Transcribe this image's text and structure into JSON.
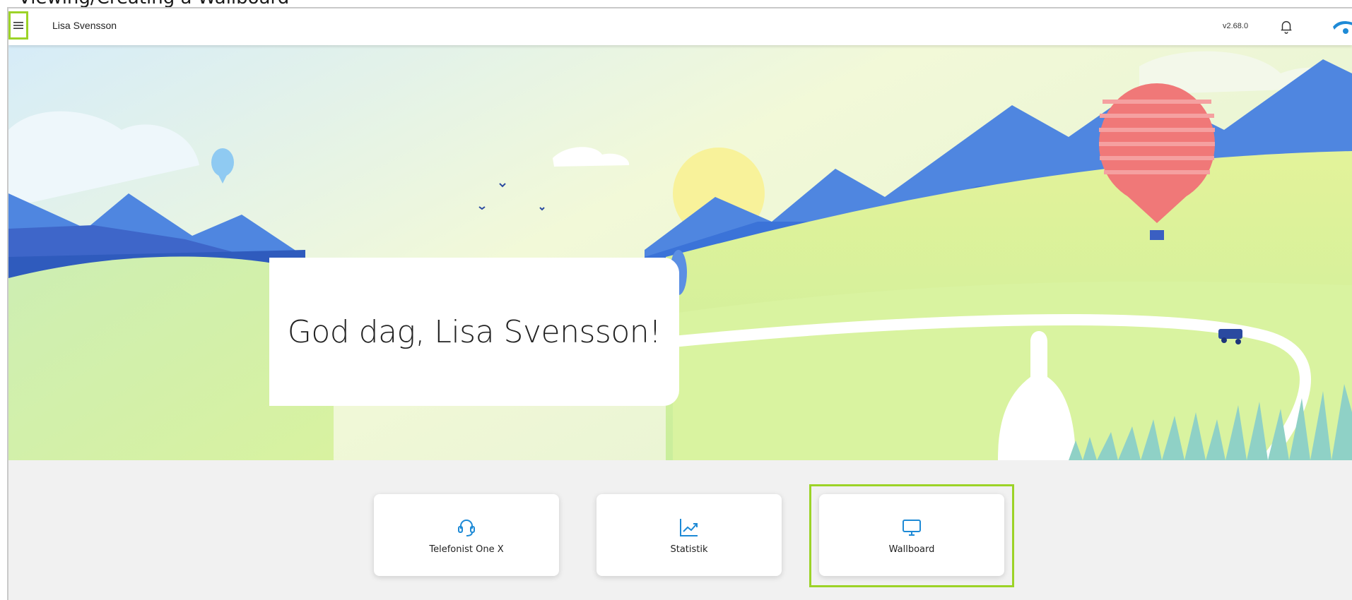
{
  "top_fragment": "Viewing/Creating a Wallboard",
  "header": {
    "user_name": "Lisa Svensson",
    "version": "v2.68.0",
    "menu_icon": "hamburger-icon",
    "bell_icon": "bell-icon",
    "logo_icon": "brand-logo"
  },
  "hero": {
    "greeting": "God dag, Lisa Svensson!"
  },
  "tiles": [
    {
      "label": "Telefonist One X",
      "icon": "headset-icon"
    },
    {
      "label": "Statistik",
      "icon": "chart-icon"
    },
    {
      "label": "Wallboard",
      "icon": "monitor-icon"
    }
  ],
  "colors": {
    "highlight": "#9cd327",
    "brand": "#1e8ad6",
    "mountain": "#4f86e0",
    "meadow": "#d6f08a",
    "balloon": "#f07878"
  }
}
